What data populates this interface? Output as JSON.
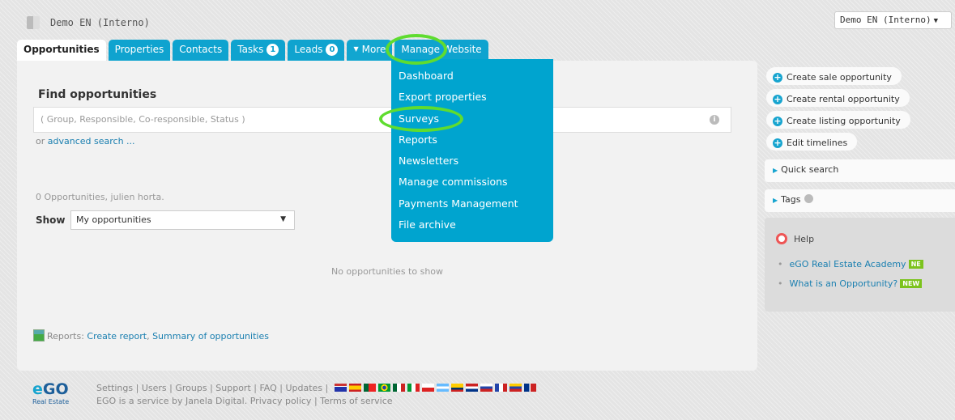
{
  "header": {
    "app_title": "Demo EN (Interno)",
    "account_select": "Demo EN (Interno)"
  },
  "tabs": [
    {
      "label": "Opportunities"
    },
    {
      "label": "Properties"
    },
    {
      "label": "Contacts"
    },
    {
      "label": "Tasks",
      "badge": "1"
    },
    {
      "label": "Leads",
      "badge": "0"
    },
    {
      "label": "More"
    },
    {
      "label": "Manage Website"
    }
  ],
  "more_menu": {
    "items": [
      "Dashboard",
      "Export properties",
      "Surveys",
      "Reports",
      "Newsletters",
      "Manage commissions",
      "Payments Management",
      "File archive"
    ]
  },
  "main": {
    "find_title": "Find opportunities",
    "search_placeholder": "( Group, Responsible, Co-responsible, Status )",
    "advanced_prefix": "or",
    "advanced_link": "advanced search ...",
    "count_text": "0 Opportunities, julien horta.",
    "show_label": "Show",
    "show_value": "My opportunities",
    "empty_text": "No opportunities to show",
    "reports_label": "Reports:",
    "create_report": "Create report",
    "summary": "Summary of opportunities"
  },
  "sidebar": {
    "actions": [
      "Create sale opportunity",
      "Create rental opportunity",
      "Create listing opportunity",
      "Edit timelines"
    ],
    "quick_search": "Quick search",
    "tags": "Tags",
    "help_title": "Help",
    "help_links": [
      {
        "label": "eGO Real Estate Academy",
        "badge": "NE"
      },
      {
        "label": "What is an Opportunity?",
        "badge": "NEW"
      }
    ]
  },
  "footer": {
    "links": [
      "Settings",
      "Users",
      "Groups",
      "Support",
      "FAQ",
      "Updates"
    ],
    "service_text": "EGO is a service by Janela Digital.",
    "privacy": "Privacy policy",
    "terms": "Terms of service",
    "logo_text": "eGO",
    "logo_sub": "Real Estate"
  },
  "colors": {
    "accent": "#0fa3cf",
    "highlight_ring": "#5fdc2f",
    "new_badge": "#7cc31d"
  }
}
